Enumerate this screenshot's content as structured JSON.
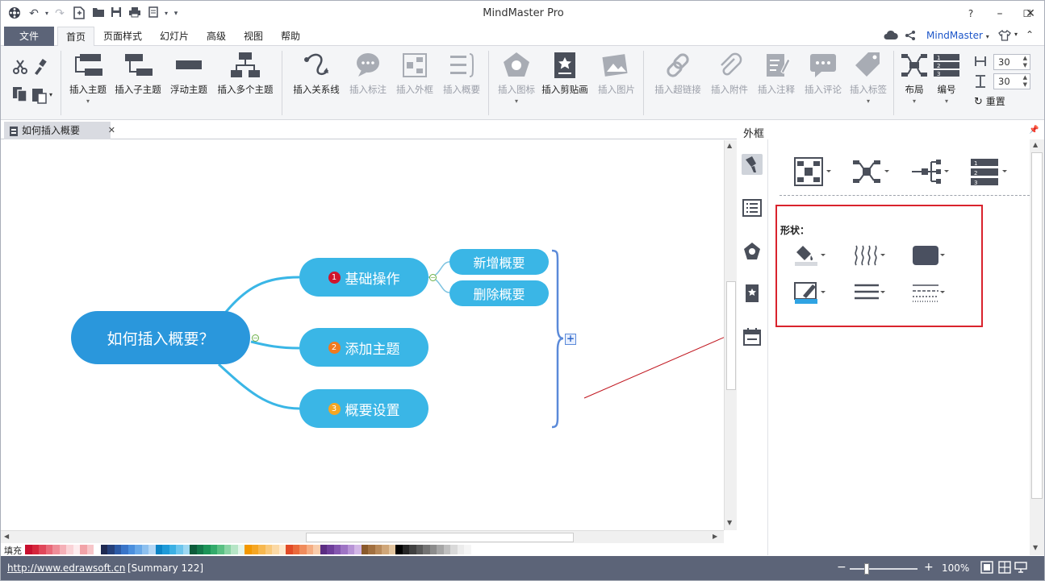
{
  "window": {
    "title": "MindMaster Pro"
  },
  "menu": {
    "file": "文件",
    "tabs": [
      "首页",
      "页面样式",
      "幻灯片",
      "高级",
      "视图",
      "帮助"
    ],
    "brand": "MindMaster"
  },
  "ribbon": {
    "insert_topic": "插入主题",
    "insert_subtopic": "插入子主题",
    "floating_topic": "浮动主题",
    "insert_multiple": "插入多个主题",
    "insert_relation": "插入关系线",
    "insert_callout": "插入标注",
    "insert_boundary": "插入外框",
    "insert_summary": "插入概要",
    "insert_icon": "插入图标",
    "insert_clipart": "插入剪贴画",
    "insert_image": "插入图片",
    "insert_hyperlink": "插入超链接",
    "insert_attachment": "插入附件",
    "insert_note": "插入注释",
    "insert_comment": "插入评论",
    "insert_tag": "插入标签",
    "layout": "布局",
    "numbering": "编号",
    "spacing_h": "30",
    "spacing_v": "30",
    "reset": "重置"
  },
  "document": {
    "tab_title": "如何插入概要"
  },
  "mindmap": {
    "root": "如何插入概要？",
    "topics": [
      {
        "num": "1",
        "label": "基础操作",
        "num_color": "#d0142c"
      },
      {
        "num": "2",
        "label": "添加主题",
        "num_color": "#f07a1e"
      },
      {
        "num": "3",
        "label": "概要设置",
        "num_color": "#f5a623"
      }
    ],
    "subtopics": [
      "新增概要",
      "删除概要"
    ],
    "root_color": "#2a97dc",
    "topic_color": "#3ab6e6"
  },
  "panel": {
    "title": "外框",
    "shape_label": "形状："
  },
  "colorbar": {
    "fill_label": "填充"
  },
  "status": {
    "url": "http://www.edrawsoft.cn",
    "summary": "[Summary 122]",
    "zoom": "100%"
  }
}
